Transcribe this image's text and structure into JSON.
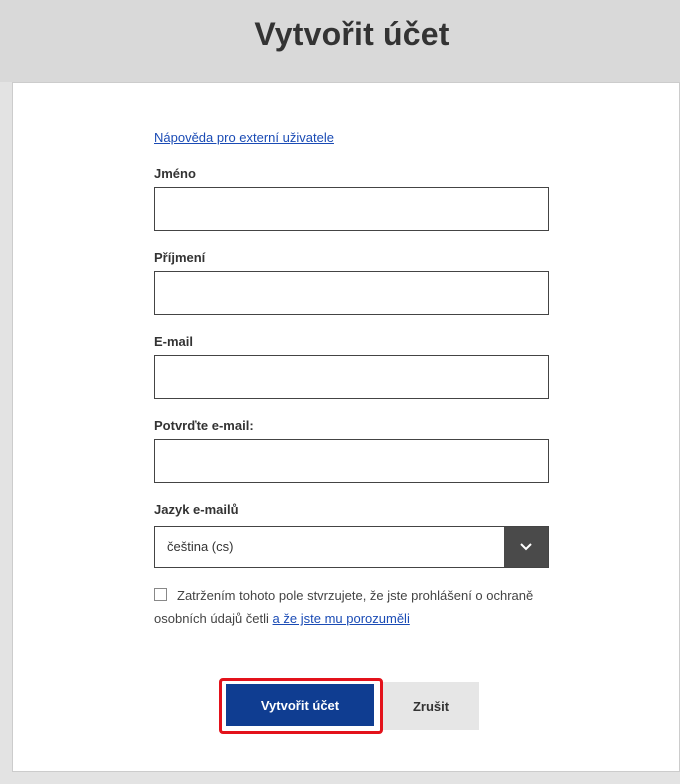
{
  "header": {
    "title": "Vytvořit účet"
  },
  "form": {
    "help_link": "Nápověda pro externí uživatele",
    "first_name": {
      "label": "Jméno",
      "value": ""
    },
    "last_name": {
      "label": "Příjmení",
      "value": ""
    },
    "email": {
      "label": "E-mail",
      "value": ""
    },
    "confirm_email": {
      "label": "Potvrďte e-mail:",
      "value": ""
    },
    "email_language": {
      "label": "Jazyk e-mailů",
      "selected": "čeština (cs)",
      "icon": "chevron-down-icon"
    },
    "consent": {
      "checked": false,
      "text": "Zatržením tohoto pole stvrzujete, že jste prohlášení o ochraně osobních údajů četli",
      "link_text": "a že jste mu porozuměli"
    }
  },
  "actions": {
    "create_label": "Vytvořit účet",
    "cancel_label": "Zrušit"
  },
  "colors": {
    "primary_button": "#0f3d91",
    "highlight_outline": "#e3121b",
    "link": "#1a4bb5",
    "header_background": "#d9d9d9"
  }
}
